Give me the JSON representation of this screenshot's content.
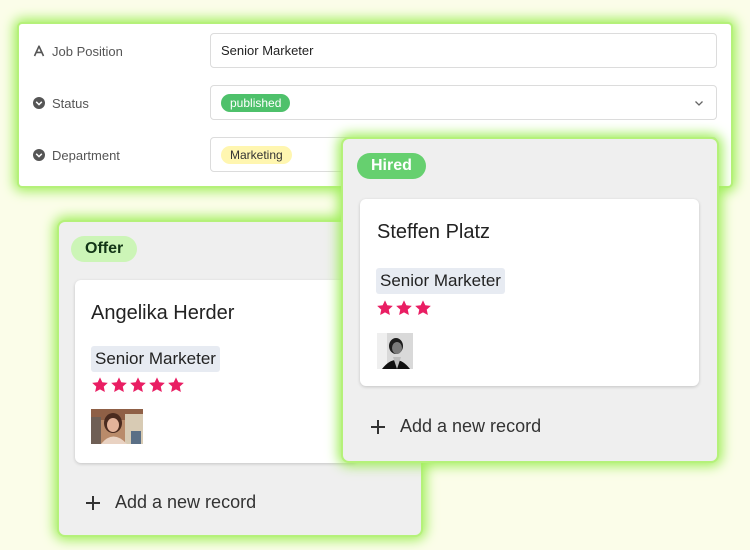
{
  "form": {
    "fields": [
      {
        "label": "Job Position",
        "icon": "text-type-icon",
        "value": "Senior Marketer"
      },
      {
        "label": "Status",
        "icon": "dropdown-icon",
        "value": "published"
      },
      {
        "label": "Department",
        "icon": "dropdown-icon",
        "value": "Marketing"
      }
    ]
  },
  "board": {
    "columns": [
      {
        "title": "Offer",
        "badge_color": "#ccf5b7",
        "cards": [
          {
            "name": "Angelika Herder",
            "role": "Senior Marketer",
            "rating": 5,
            "avatar": "photo-avatar-woman"
          }
        ],
        "add_label": "Add a new record"
      },
      {
        "title": "Hired",
        "badge_color": "#66d06f",
        "cards": [
          {
            "name": "Steffen Platz",
            "role": "Senior Marketer",
            "rating": 3,
            "avatar": "photo-avatar-man-bw"
          }
        ],
        "add_label": "Add a new record"
      }
    ]
  },
  "colors": {
    "highlight_glow": "#9eee58",
    "star": "#e91e63",
    "published": "#4ec16b",
    "marketing": "#fff6b0",
    "background": "#fbfde9"
  }
}
